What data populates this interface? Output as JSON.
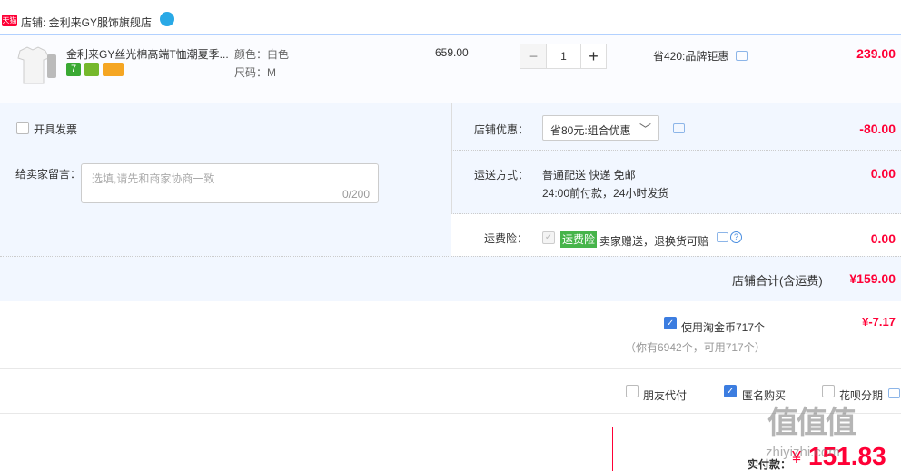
{
  "shop": {
    "badge": "天猫",
    "label": "店铺: 金利来GY服饰旗舰店"
  },
  "item": {
    "title": "金利来GY丝光棉高端T恤潮夏季...",
    "color": "颜色：白色",
    "size": "尺码：M",
    "price": "659.00",
    "qty": "1",
    "qty_minus": "−",
    "qty_plus": "+",
    "promo": "省420:品牌钜惠",
    "subtotal": "239.00",
    "badge_7": "7"
  },
  "invoice": {
    "label": "开具发票"
  },
  "shop_discount": {
    "label": "店铺优惠：",
    "selected": "省80元:组合优惠",
    "amount": "-80.00"
  },
  "note": {
    "label": "给卖家留言：",
    "placeholder": "选填,请先和商家协商一致",
    "counter": "0/200"
  },
  "shipping": {
    "label": "运送方式：",
    "method": "普通配送 快递 免邮",
    "time": "24:00前付款，24小时发货",
    "amount": "0.00"
  },
  "insurance": {
    "label": "运费险：",
    "tag": "运费险",
    "desc": "卖家赠送，退换货可赔",
    "amount": "0.00"
  },
  "shop_total": {
    "label": "店铺合计(含运费)",
    "amount": "¥159.00"
  },
  "coins": {
    "label": "使用淘金币717个",
    "hint": "（你有6942个，可用717个）",
    "amount": "¥-7.17"
  },
  "options": {
    "friend_pay": "朋友代付",
    "anonymous": "匿名购买",
    "huabei": "花呗分期"
  },
  "final": {
    "label": "实付款：",
    "currency": "¥",
    "amount": "151.83"
  },
  "watermark": {
    "main": "值值值",
    "sub": "zhiyizhi.com"
  },
  "colors": {
    "accent": "#ff0036",
    "blue": "#3c7de0",
    "panel": "#f2f7ff"
  }
}
